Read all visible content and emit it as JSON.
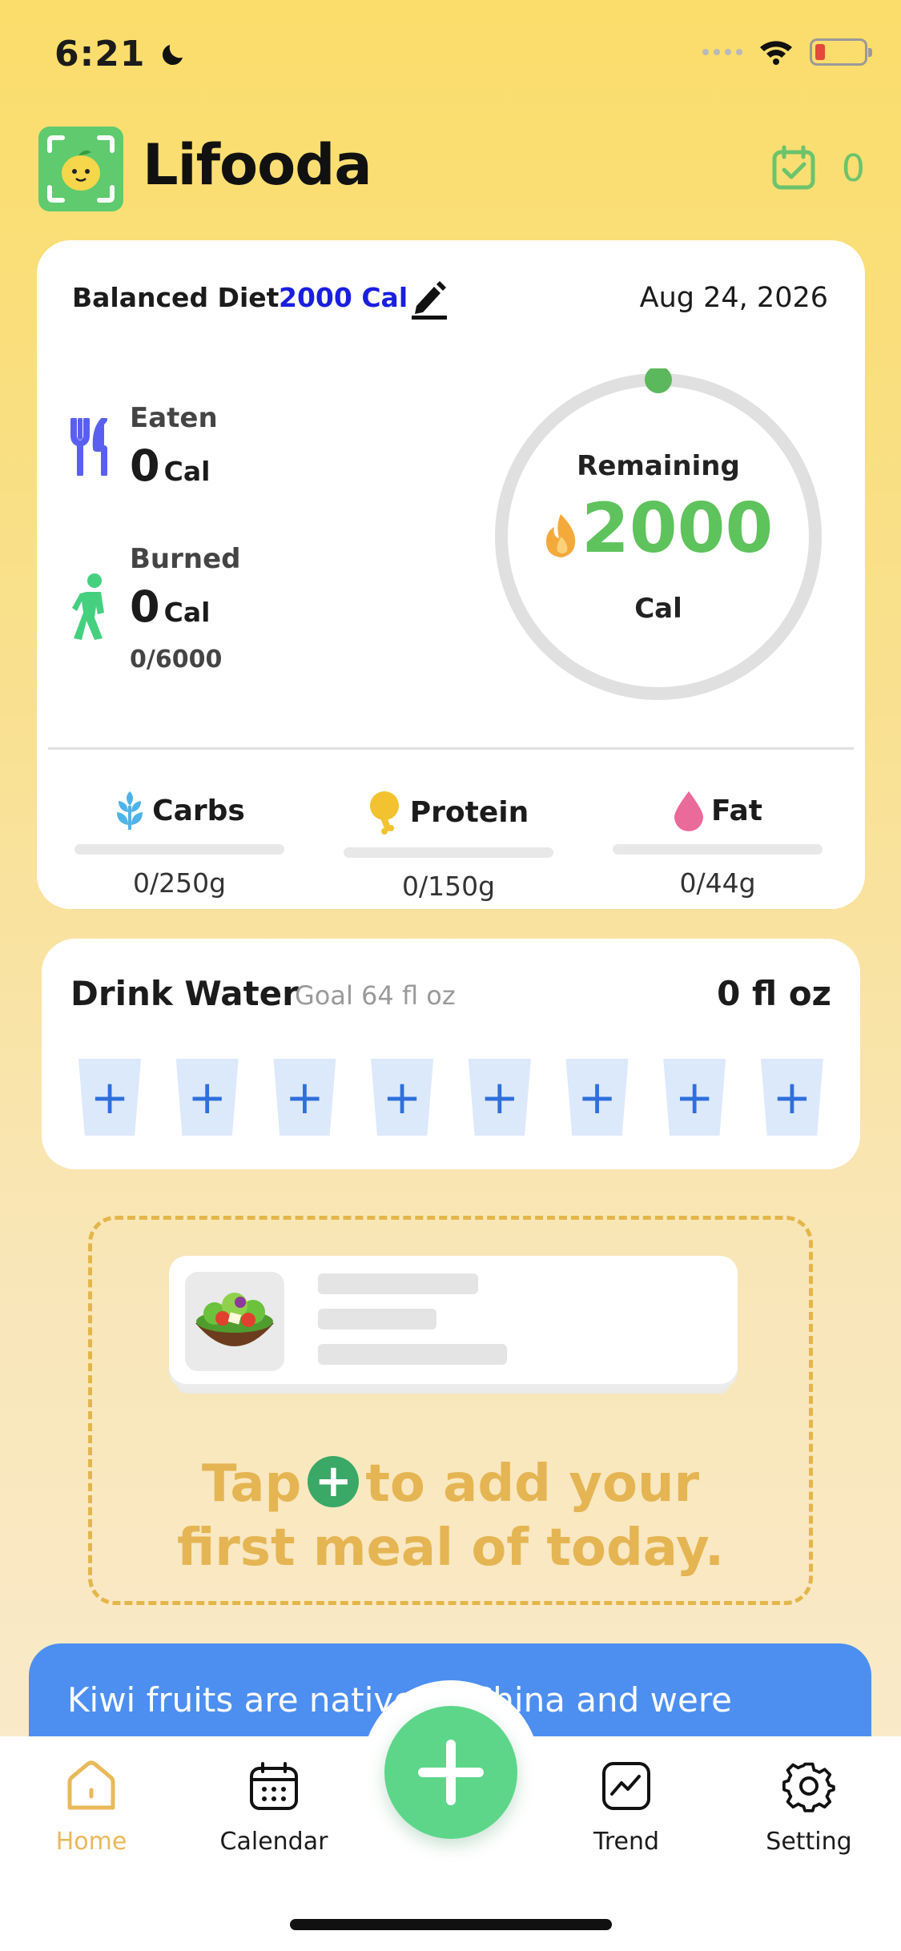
{
  "status_bar": {
    "time": "6:21"
  },
  "header": {
    "app_name": "Lifooda",
    "checkin_count": "0"
  },
  "summary": {
    "diet_name": "Balanced Diet",
    "diet_goal": "2000 Cal",
    "date": "Aug 24, 2026",
    "eaten": {
      "label": "Eaten",
      "value": "0",
      "unit": "Cal"
    },
    "burned": {
      "label": "Burned",
      "value": "0",
      "unit": "Cal",
      "steps": "0/6000"
    },
    "remaining": {
      "label": "Remaining",
      "value": "2000",
      "unit": "Cal",
      "progress": 0
    },
    "macros": [
      {
        "name": "Carbs",
        "value": "0/250g",
        "progress": 0,
        "color": "#4fb3e8"
      },
      {
        "name": "Protein",
        "value": "0/150g",
        "progress": 0,
        "color": "#f2c230"
      },
      {
        "name": "Fat",
        "value": "0/44g",
        "progress": 0,
        "color": "#ea6a9a"
      }
    ]
  },
  "water": {
    "title": "Drink Water",
    "goal": "Goal 64 fl oz",
    "amount": "0 fl oz",
    "cups": [
      "+",
      "+",
      "+",
      "+",
      "+",
      "+",
      "+",
      "+"
    ]
  },
  "empty_state": {
    "line1_pre": "Tap",
    "line1_post": "to add your",
    "line2": "first meal of today."
  },
  "tip": {
    "text": "Kiwi fruits are native to China and were"
  },
  "nav": {
    "home": "Home",
    "calendar": "Calendar",
    "trend": "Trend",
    "setting": "Setting"
  },
  "colors": {
    "accent_green": "#5ec35c",
    "diet_blue": "#1a1ee0",
    "active_tab": "#e9b95a",
    "tip_blue": "#4d8ff0"
  }
}
